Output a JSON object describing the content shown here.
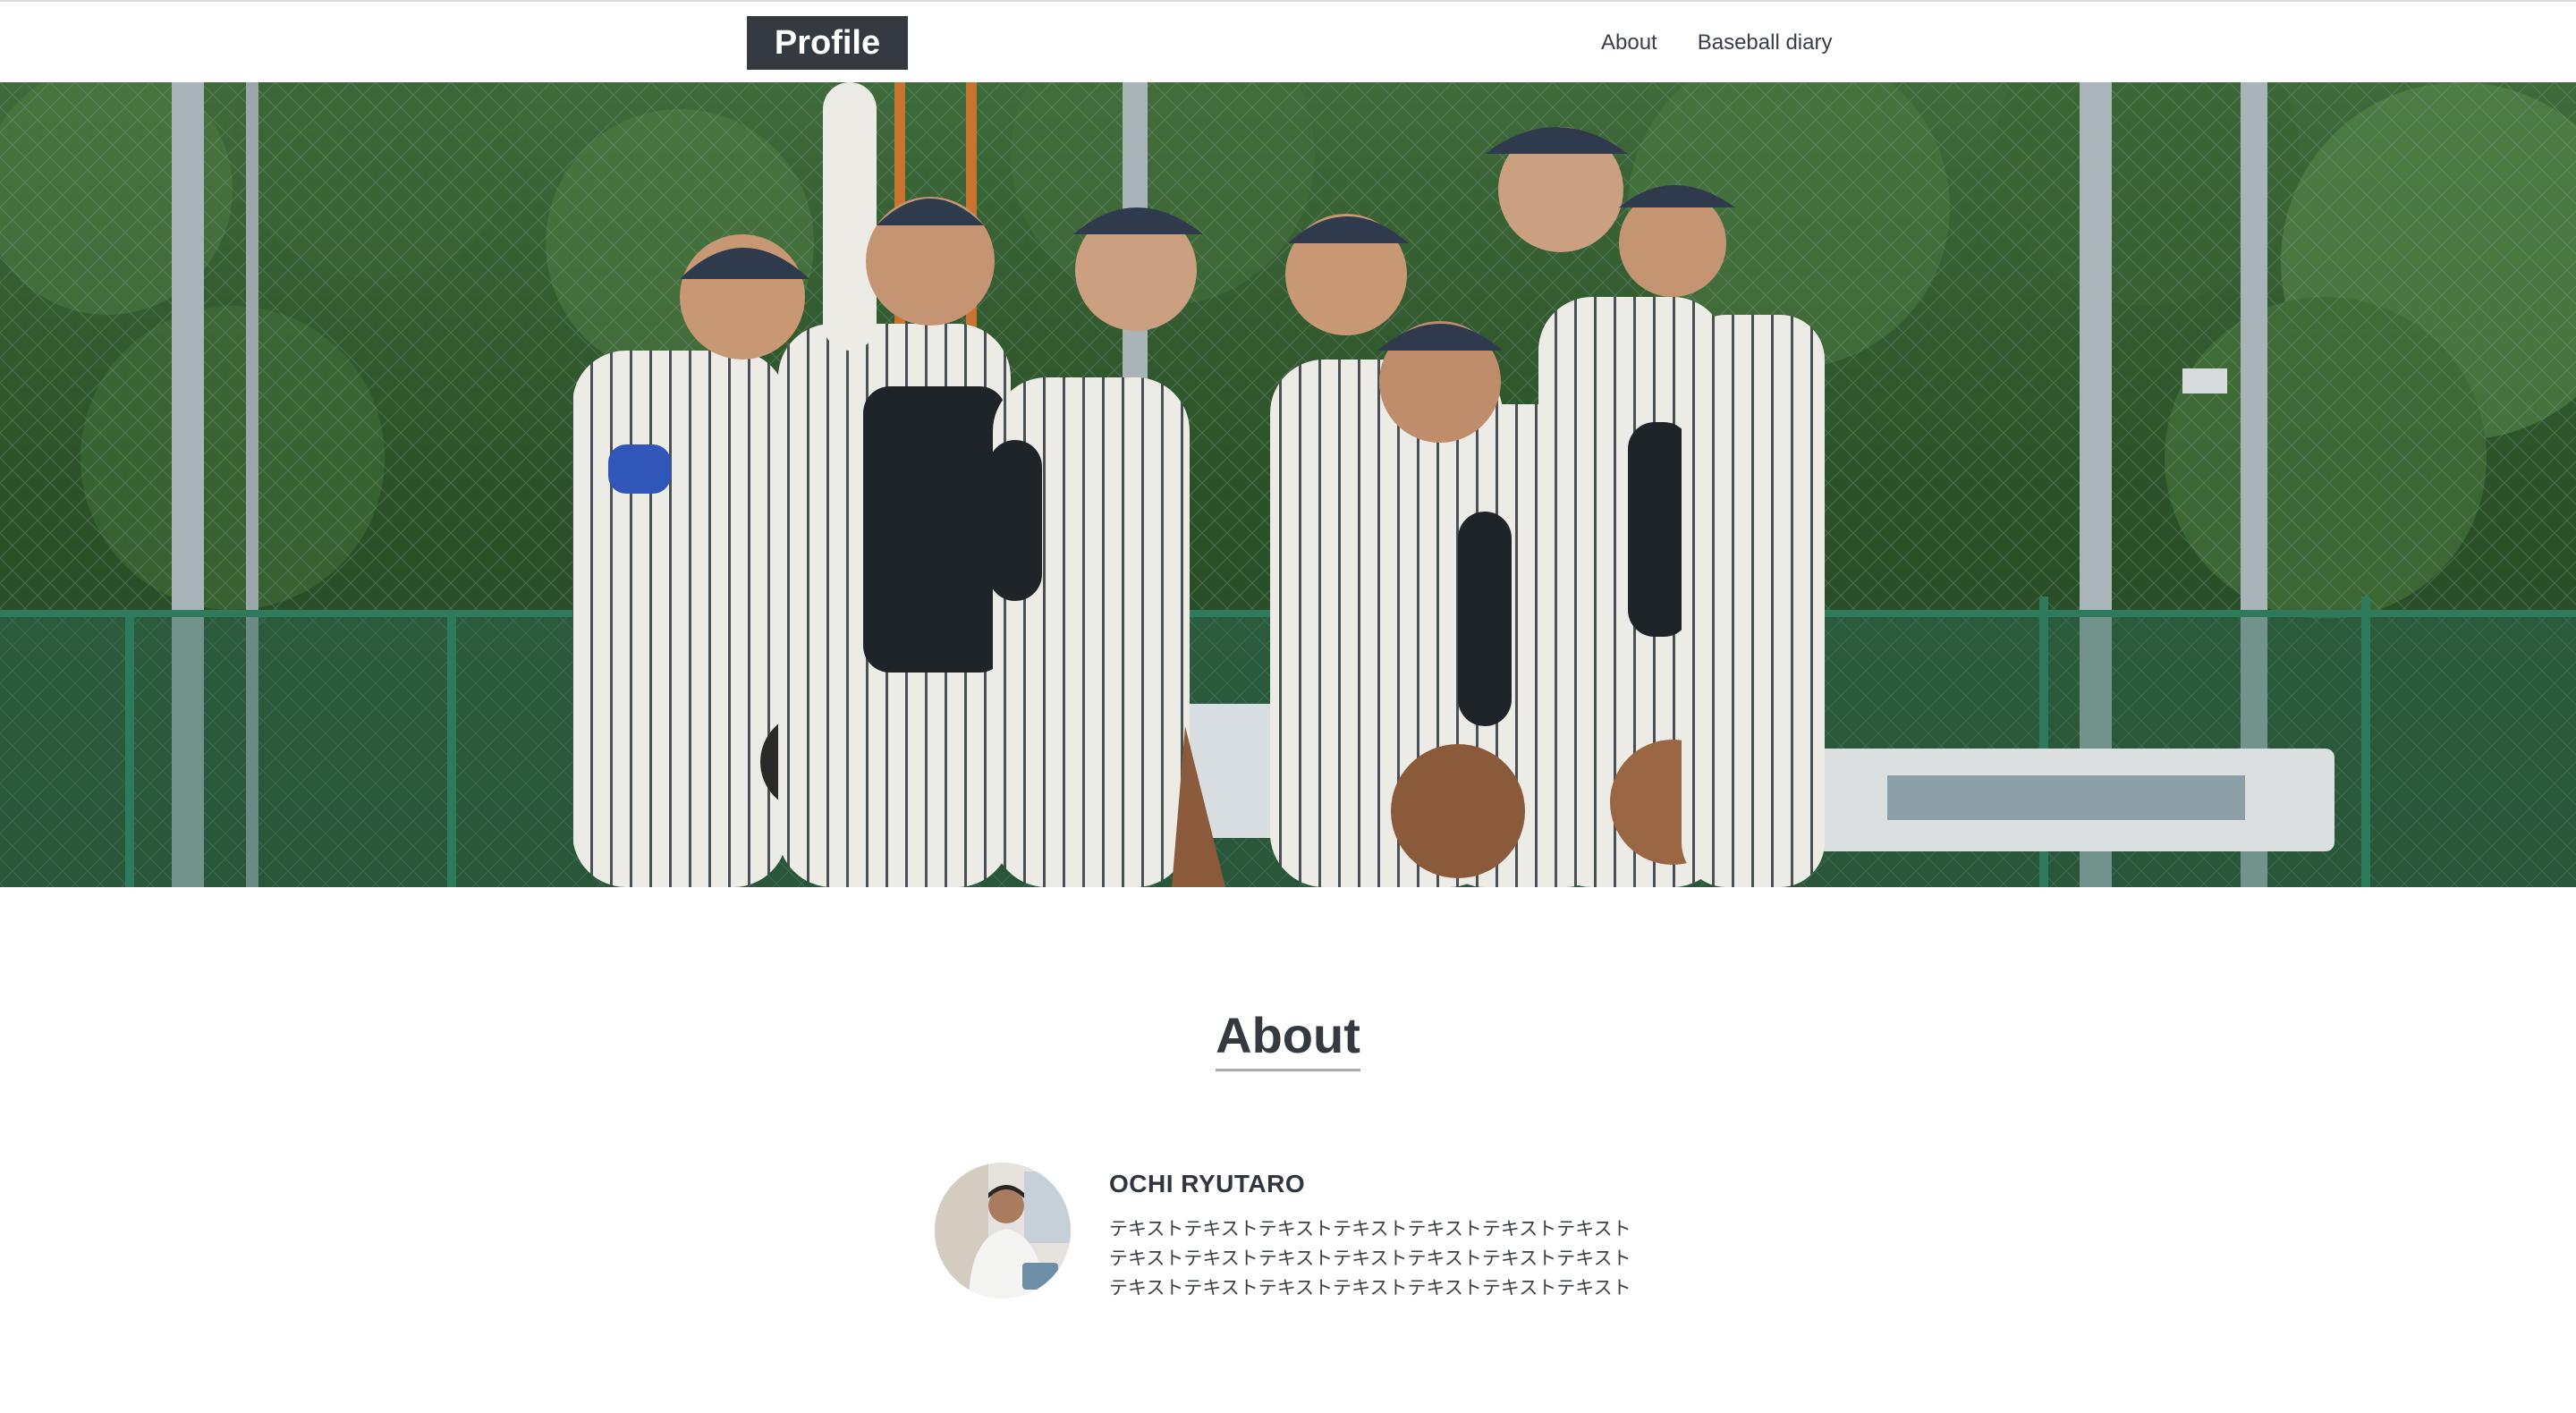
{
  "header": {
    "logo": "Profile",
    "nav": [
      {
        "label": "About"
      },
      {
        "label": "Baseball diary"
      }
    ]
  },
  "hero": {
    "image_icon": "baseball-team-photo"
  },
  "about": {
    "title": "About",
    "avatar_icon": "user-avatar-photo",
    "name": "OCHI RYUTARO",
    "bio_lines": [
      "テキストテキストテキストテキストテキストテキストテキスト",
      "テキストテキストテキストテキストテキストテキストテキスト",
      "テキストテキストテキストテキストテキストテキストテキスト"
    ]
  },
  "colors": {
    "logo_bg": "#343a40",
    "text": "#2f3640",
    "underline": "#a9adb2"
  }
}
